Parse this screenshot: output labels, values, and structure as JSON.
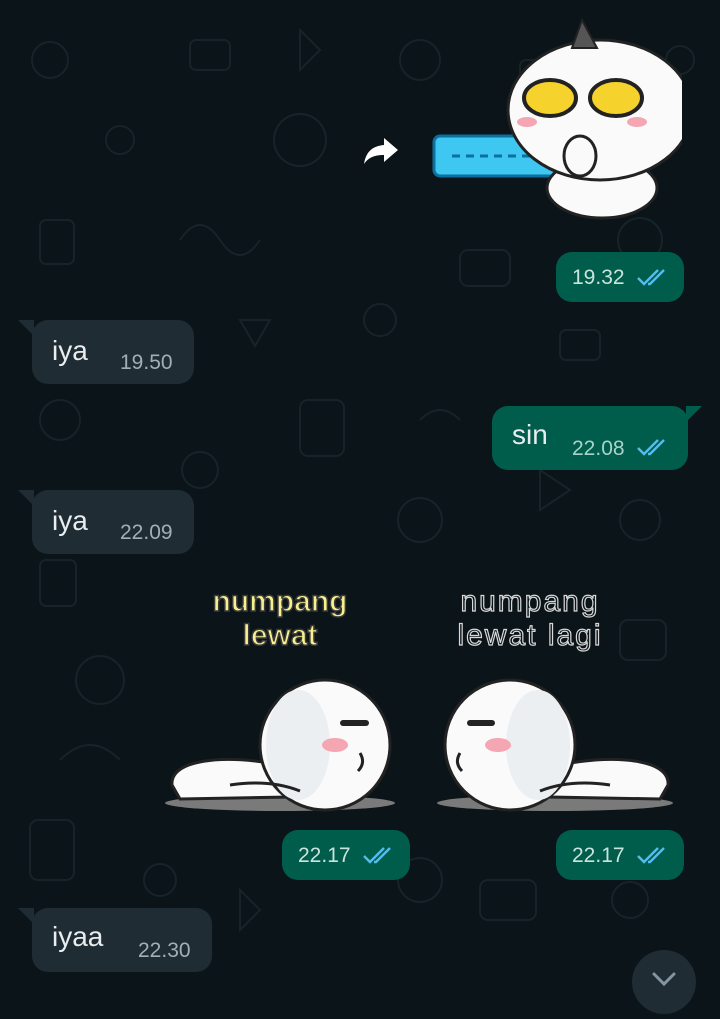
{
  "colors": {
    "background": "#0b1418",
    "incoming_bubble": "#1f2c33",
    "outgoing_bubble": "#005c4b",
    "read_ticks": "#53bdeb"
  },
  "messages": [
    {
      "direction": "outgoing",
      "type": "sticker",
      "icon": "gun-sticker",
      "time": "19.32",
      "status": "read"
    },
    {
      "direction": "incoming",
      "type": "text",
      "text": "iya",
      "time": "19.50"
    },
    {
      "direction": "outgoing",
      "type": "text",
      "text": "sin",
      "time": "22.08",
      "status": "read"
    },
    {
      "direction": "incoming",
      "type": "text",
      "text": "iya",
      "time": "22.09"
    },
    {
      "direction": "outgoing",
      "type": "sticker",
      "icon": "lying-character-sticker",
      "caption_line1": "numpang",
      "caption_line2": "lewat",
      "time": "22.17",
      "status": "read"
    },
    {
      "direction": "outgoing",
      "type": "sticker",
      "icon": "lying-character-sticker",
      "caption_line1": "numpang",
      "caption_line2": "lewat lagi",
      "time": "22.17",
      "status": "read"
    },
    {
      "direction": "incoming",
      "type": "text",
      "text": "iyaa",
      "time": "22.30"
    }
  ],
  "icons": {
    "forward": "forward-arrow-icon",
    "scroll_down": "chevron-down-icon"
  }
}
